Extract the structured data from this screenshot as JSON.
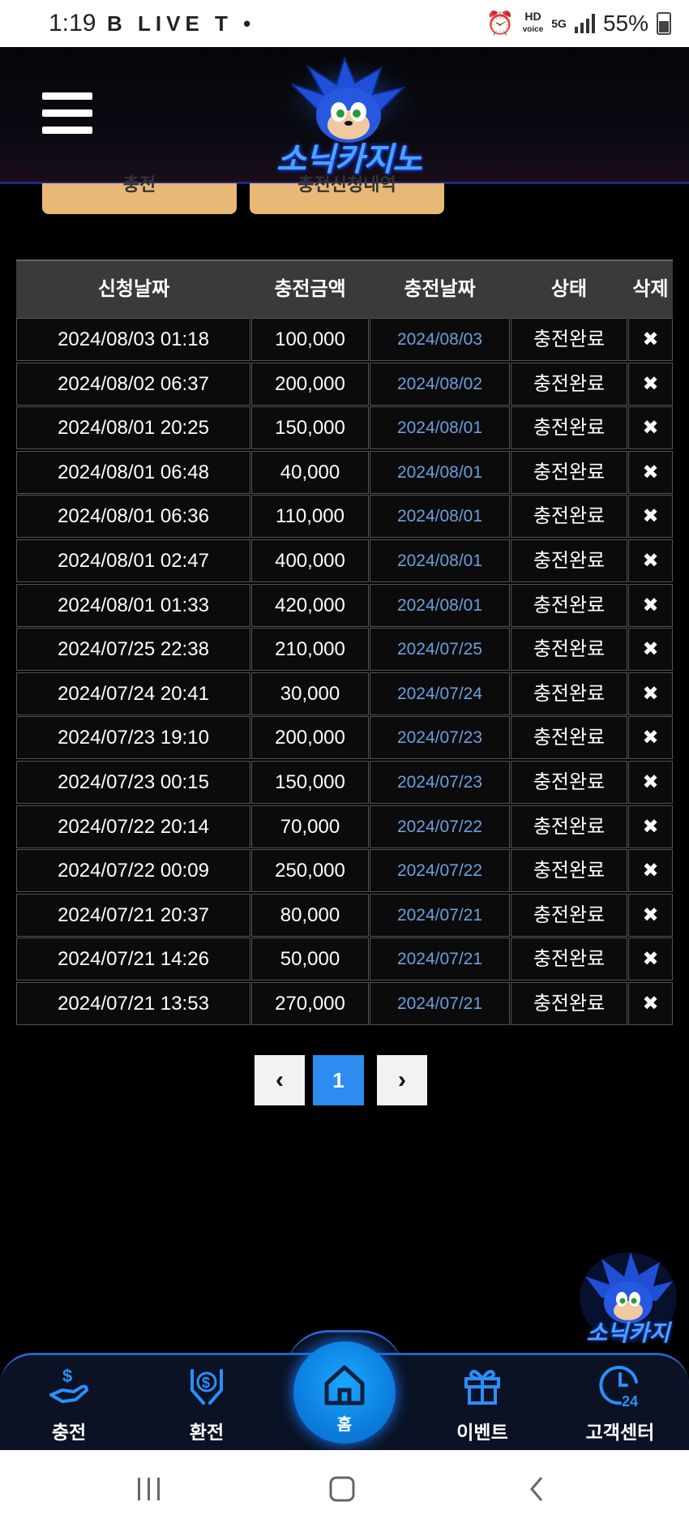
{
  "status_bar": {
    "time": "1:19",
    "left_icons": "B LIVE T •",
    "hd_label": "HD",
    "voice_label": "voice",
    "network": "5G",
    "battery": "55%"
  },
  "header": {
    "logo_text": "소닉카지노"
  },
  "top_tabs": [
    "충전",
    "충전신청내역"
  ],
  "table": {
    "columns": [
      "신청날짜",
      "충전금액",
      "충전날짜",
      "상태",
      "삭제"
    ],
    "rows": [
      {
        "req": "2024/08/03 01:18",
        "amount": "100,000",
        "date": "2024/08/03",
        "status": "충전완료",
        "del": "✖"
      },
      {
        "req": "2024/08/02 06:37",
        "amount": "200,000",
        "date": "2024/08/02",
        "status": "충전완료",
        "del": "✖"
      },
      {
        "req": "2024/08/01 20:25",
        "amount": "150,000",
        "date": "2024/08/01",
        "status": "충전완료",
        "del": "✖"
      },
      {
        "req": "2024/08/01 06:48",
        "amount": "40,000",
        "date": "2024/08/01",
        "status": "충전완료",
        "del": "✖"
      },
      {
        "req": "2024/08/01 06:36",
        "amount": "110,000",
        "date": "2024/08/01",
        "status": "충전완료",
        "del": "✖"
      },
      {
        "req": "2024/08/01 02:47",
        "amount": "400,000",
        "date": "2024/08/01",
        "status": "충전완료",
        "del": "✖"
      },
      {
        "req": "2024/08/01 01:33",
        "amount": "420,000",
        "date": "2024/08/01",
        "status": "충전완료",
        "del": "✖"
      },
      {
        "req": "2024/07/25 22:38",
        "amount": "210,000",
        "date": "2024/07/25",
        "status": "충전완료",
        "del": "✖"
      },
      {
        "req": "2024/07/24 20:41",
        "amount": "30,000",
        "date": "2024/07/24",
        "status": "충전완료",
        "del": "✖"
      },
      {
        "req": "2024/07/23 19:10",
        "amount": "200,000",
        "date": "2024/07/23",
        "status": "충전완료",
        "del": "✖"
      },
      {
        "req": "2024/07/23 00:15",
        "amount": "150,000",
        "date": "2024/07/23",
        "status": "충전완료",
        "del": "✖"
      },
      {
        "req": "2024/07/22 20:14",
        "amount": "70,000",
        "date": "2024/07/22",
        "status": "충전완료",
        "del": "✖"
      },
      {
        "req": "2024/07/22 00:09",
        "amount": "250,000",
        "date": "2024/07/22",
        "status": "충전완료",
        "del": "✖"
      },
      {
        "req": "2024/07/21 20:37",
        "amount": "80,000",
        "date": "2024/07/21",
        "status": "충전완료",
        "del": "✖"
      },
      {
        "req": "2024/07/21 14:26",
        "amount": "50,000",
        "date": "2024/07/21",
        "status": "충전완료",
        "del": "✖"
      },
      {
        "req": "2024/07/21 13:53",
        "amount": "270,000",
        "date": "2024/07/21",
        "status": "충전완료",
        "del": "✖"
      }
    ]
  },
  "pagination": {
    "prev": "‹",
    "current": "1",
    "next": "›"
  },
  "floating_logo_text": "소닉카지",
  "bottom_nav": {
    "deposit": "충전",
    "withdraw": "환전",
    "home": "홈",
    "event": "이벤트",
    "support": "고객센터",
    "support_badge": "24"
  },
  "colors": {
    "accent": "#2d8cf0",
    "tab_bg": "#e8b876",
    "date_link": "#6a9fe0",
    "nav_border": "#2a62c8"
  }
}
